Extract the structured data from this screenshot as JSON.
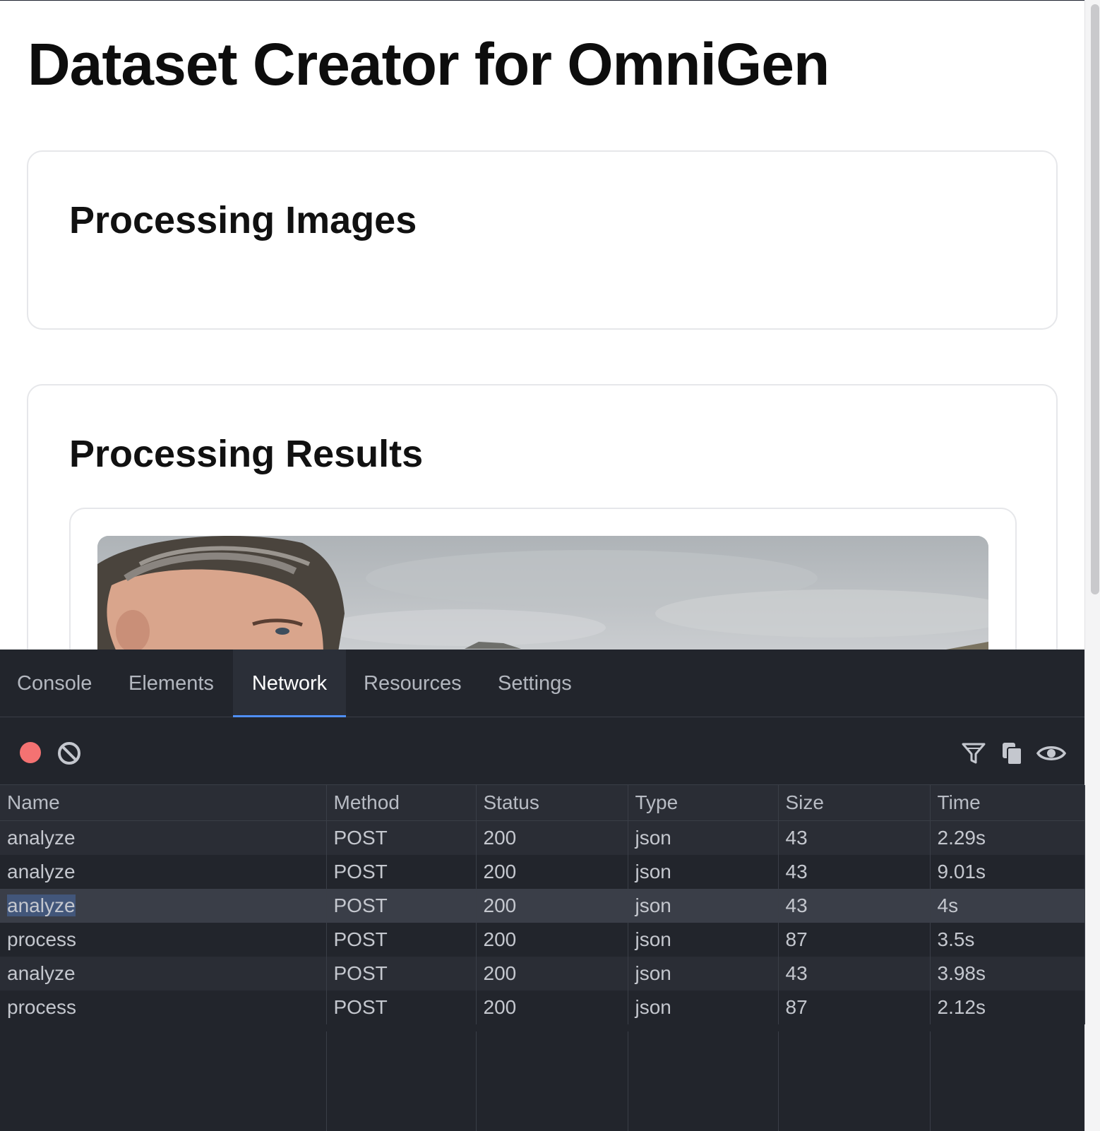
{
  "page": {
    "title": "Dataset Creator for OmniGen",
    "sections": {
      "images_heading": "Processing Images",
      "results_heading": "Processing Results"
    }
  },
  "devtools": {
    "tabs": [
      {
        "label": "Console"
      },
      {
        "label": "Elements"
      },
      {
        "label": "Network",
        "active": true
      },
      {
        "label": "Resources"
      },
      {
        "label": "Settings"
      }
    ],
    "toolbar": {
      "record_icon": "record-icon",
      "clear_icon": "clear-icon",
      "filter_icon": "filter-icon",
      "copy_icon": "copy-icon",
      "preview_icon": "eye-icon",
      "record_color": "#f47272"
    },
    "network": {
      "columns": [
        "Name",
        "Method",
        "Status",
        "Type",
        "Size",
        "Time"
      ],
      "rows": [
        {
          "name": "analyze",
          "method": "POST",
          "status": "200",
          "type": "json",
          "size": "43",
          "time": "2.29s"
        },
        {
          "name": "analyze",
          "method": "POST",
          "status": "200",
          "type": "json",
          "size": "43",
          "time": "9.01s"
        },
        {
          "name": "analyze",
          "method": "POST",
          "status": "200",
          "type": "json",
          "size": "43",
          "time": "4s",
          "selected": true
        },
        {
          "name": "process",
          "method": "POST",
          "status": "200",
          "type": "json",
          "size": "87",
          "time": "3.5s"
        },
        {
          "name": "analyze",
          "method": "POST",
          "status": "200",
          "type": "json",
          "size": "43",
          "time": "3.98s"
        },
        {
          "name": "process",
          "method": "POST",
          "status": "200",
          "type": "json",
          "size": "87",
          "time": "2.12s"
        }
      ]
    }
  }
}
